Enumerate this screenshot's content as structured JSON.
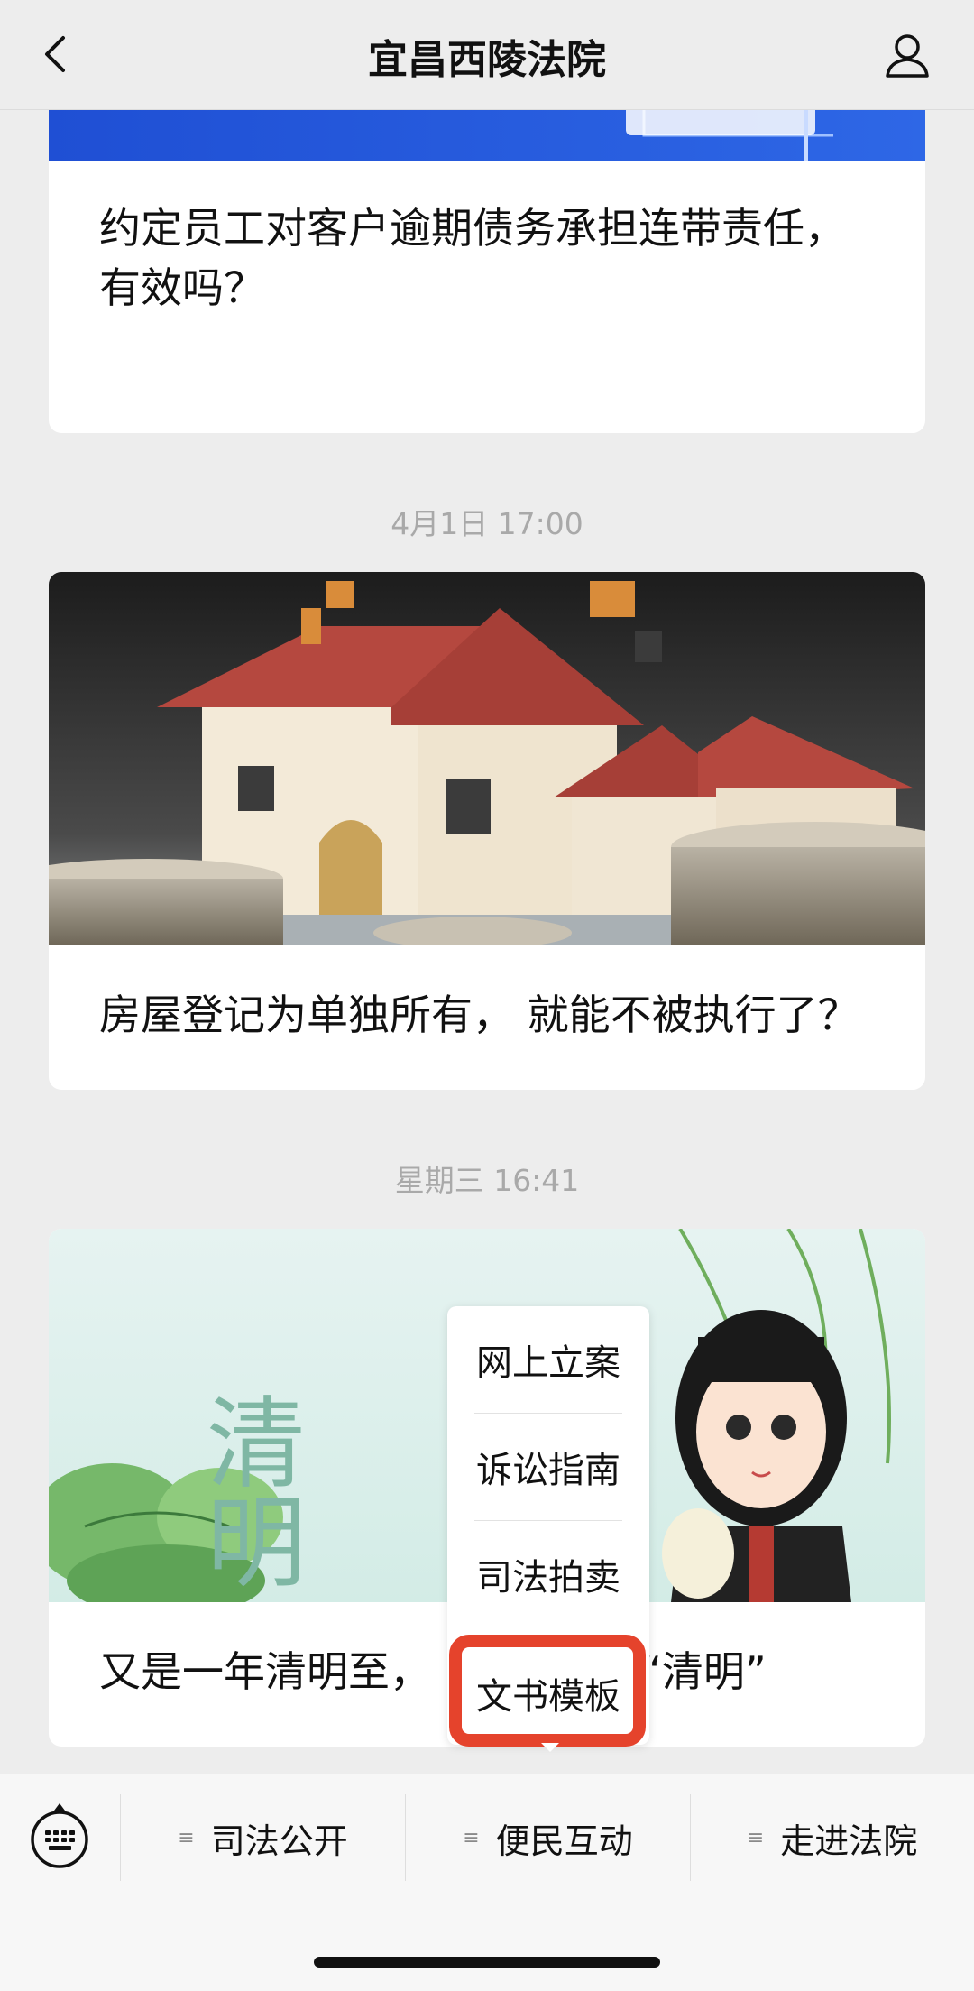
{
  "header": {
    "title": "宜昌西陵法院"
  },
  "feed": {
    "card1": {
      "title": "约定员工对客户逾期债务承担连带责任，有效吗？"
    },
    "timestamp2": "4月1日 17:00",
    "card2": {
      "title": "房屋登记为单独所有， 就能不被执行了？"
    },
    "timestamp3": "星期三 16:41",
    "card3": {
      "title": "又是一年清明至，",
      "title_suffix": "“清明”",
      "image_text": "清明"
    }
  },
  "popup_menu": {
    "items": [
      "网上立案",
      "诉讼指南",
      "司法拍卖",
      "文书模板"
    ],
    "highlighted_item": "文书模板",
    "highlight_color": "#e5432c"
  },
  "bottom_menu": {
    "items": [
      "司法公开",
      "便民互动",
      "走进法院"
    ]
  },
  "icons": [
    "back-chevron-icon",
    "user-icon",
    "keyboard-icon",
    "menu-lines-icon"
  ]
}
